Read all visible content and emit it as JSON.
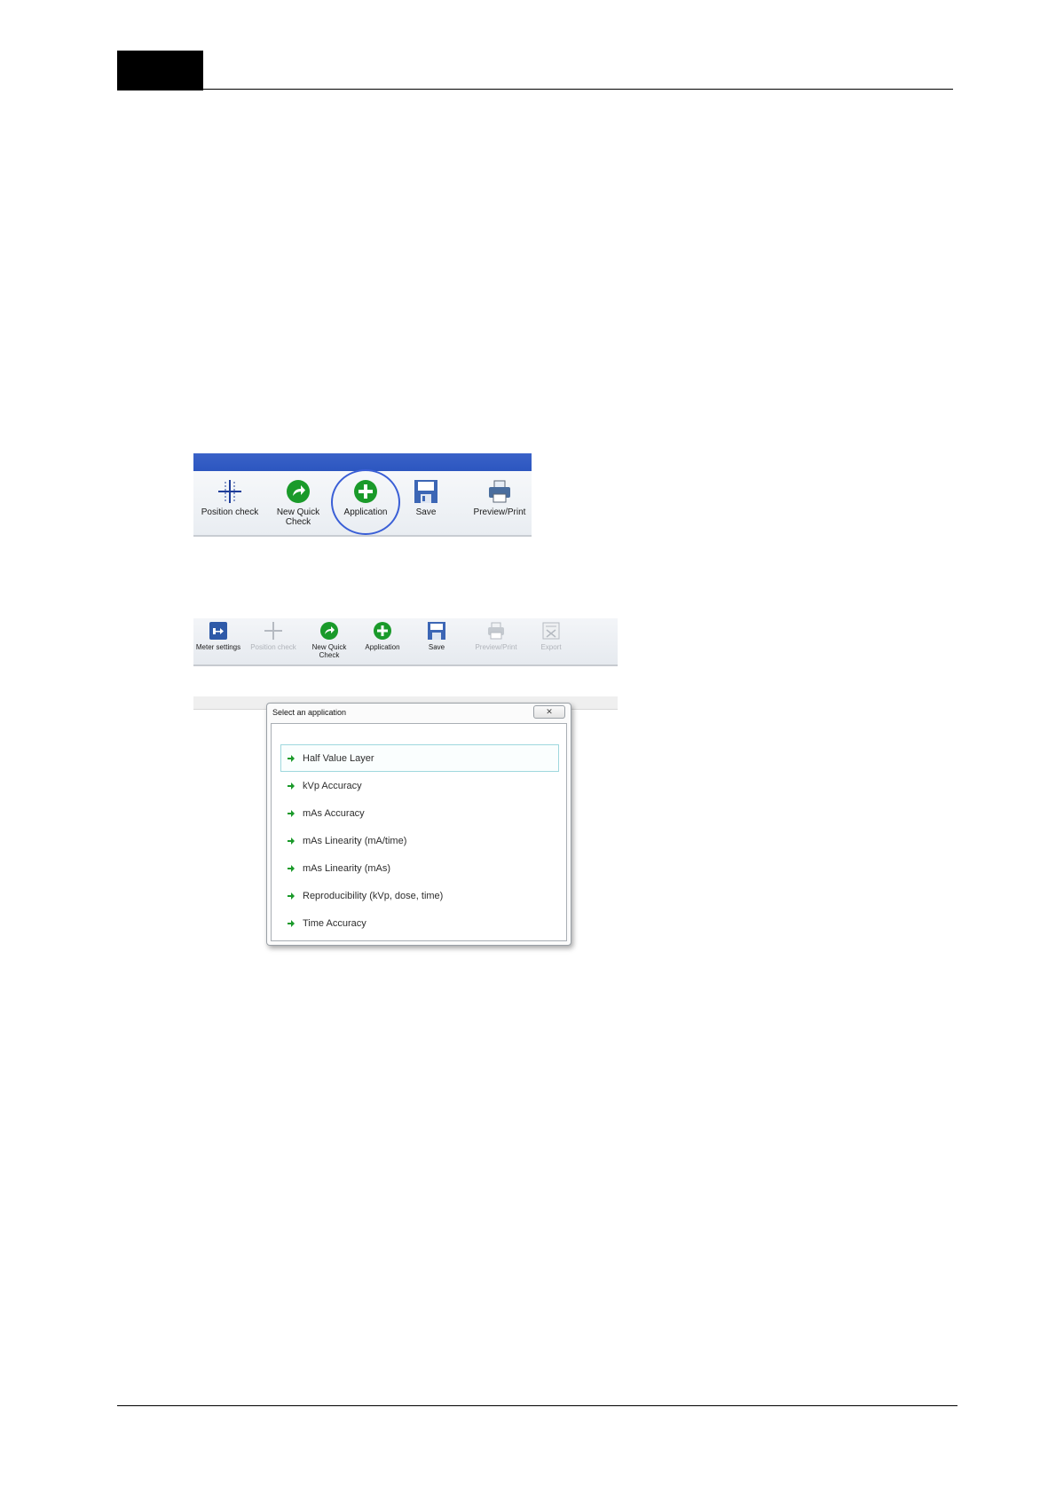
{
  "toolbar_large": {
    "buttons": [
      {
        "label": "Position check",
        "icon": "crosshair-icon"
      },
      {
        "label": "New Quick Check",
        "icon": "green-arrow-icon"
      },
      {
        "label": "Application",
        "icon": "green-plus-icon"
      },
      {
        "label": "Save",
        "icon": "floppy-disk-icon"
      },
      {
        "label": "Preview/Print",
        "icon": "printer-icon"
      }
    ],
    "highlight_color": "#3a5fd6"
  },
  "toolbar_small": {
    "buttons": [
      {
        "label": "Meter settings",
        "icon": "meter-settings-icon",
        "enabled": true
      },
      {
        "label": "Position check",
        "icon": "crosshair-icon",
        "enabled": false
      },
      {
        "label": "New Quick Check",
        "icon": "green-arrow-icon",
        "enabled": true
      },
      {
        "label": "Application",
        "icon": "green-plus-icon",
        "enabled": true
      },
      {
        "label": "Save",
        "icon": "floppy-disk-icon",
        "enabled": true
      },
      {
        "label": "Preview/Print",
        "icon": "printer-icon",
        "enabled": false
      },
      {
        "label": "Export",
        "icon": "export-icon",
        "enabled": false
      }
    ]
  },
  "dialog": {
    "title": "Select an application",
    "applications": [
      "Half Value Layer",
      "kVp Accuracy",
      "mAs Accuracy",
      "mAs Linearity (mA/time)",
      "mAs Linearity (mAs)",
      "Reproducibility (kVp, dose, time)",
      "Time Accuracy"
    ],
    "selected": "Half Value Layer"
  },
  "colors": {
    "accent_green": "#1a9a2a",
    "title_blue": "#2c56c0",
    "selection_border": "#9fd8de"
  }
}
